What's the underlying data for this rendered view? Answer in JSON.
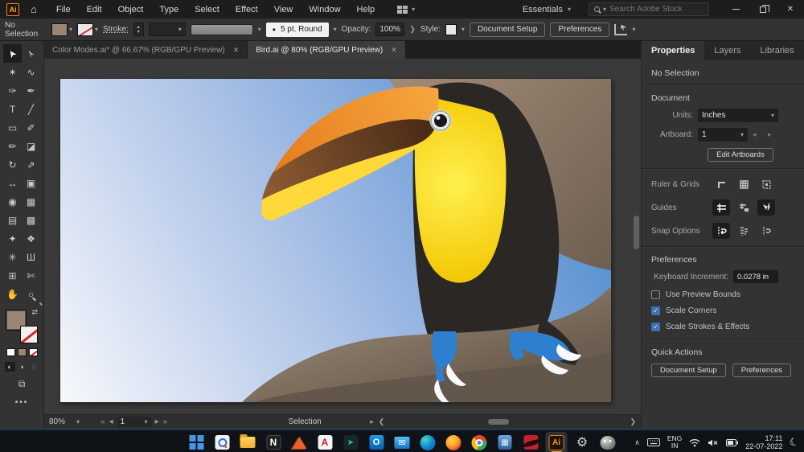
{
  "titlebar": {
    "app_logo": "Ai",
    "menus": [
      {
        "name": "menu-file",
        "label": "File"
      },
      {
        "name": "menu-edit",
        "label": "Edit"
      },
      {
        "name": "menu-object",
        "label": "Object"
      },
      {
        "name": "menu-type",
        "label": "Type"
      },
      {
        "name": "menu-select",
        "label": "Select"
      },
      {
        "name": "menu-effect",
        "label": "Effect"
      },
      {
        "name": "menu-view",
        "label": "View"
      },
      {
        "name": "menu-window",
        "label": "Window"
      },
      {
        "name": "menu-help",
        "label": "Help"
      }
    ],
    "workspace_label": "Essentials",
    "search_placeholder": "Search Adobe Stock"
  },
  "controlbar": {
    "selection_status": "No Selection",
    "stroke_label": "Stroke:",
    "brush_label": "5 pt. Round",
    "opacity_label": "Opacity:",
    "opacity_value": "100%",
    "style_label": "Style:",
    "document_setup_label": "Document Setup",
    "preferences_label": "Preferences",
    "fill_color": "#9b8674"
  },
  "document_tabs": [
    {
      "name": "tab-color-modes",
      "label": "Color Modes.ai* @ 66.67% (RGB/GPU Preview)"
    },
    {
      "name": "tab-bird",
      "label": "Bird.ai @ 80% (RGB/GPU Preview)",
      "active": true
    }
  ],
  "toolbar": {
    "tools": [
      {
        "name": "selection-tool",
        "glyph": "➤",
        "cls": "rot",
        "active": true
      },
      {
        "name": "direct-selection-tool",
        "glyph": "➢",
        "cls": "rot"
      },
      {
        "name": "magic-wand-tool",
        "glyph": "✶"
      },
      {
        "name": "lasso-tool",
        "glyph": "∿"
      },
      {
        "name": "curvature-tool",
        "glyph": "✑"
      },
      {
        "name": "pen-tool",
        "glyph": "✒"
      },
      {
        "name": "type-tool",
        "glyph": "T"
      },
      {
        "name": "line-segment-tool",
        "glyph": "╱"
      },
      {
        "name": "rectangle-tool",
        "glyph": "▭"
      },
      {
        "name": "paintbrush-tool",
        "glyph": "✐"
      },
      {
        "name": "pencil-tool",
        "glyph": "✏"
      },
      {
        "name": "eraser-tool",
        "glyph": "◪"
      },
      {
        "name": "rotate-tool",
        "glyph": "↻"
      },
      {
        "name": "scale-tool",
        "glyph": "⇗"
      },
      {
        "name": "width-tool",
        "glyph": "↔"
      },
      {
        "name": "free-transform-tool",
        "glyph": "▣"
      },
      {
        "name": "shape-builder-tool",
        "glyph": "◉"
      },
      {
        "name": "perspective-grid-tool",
        "glyph": "▦"
      },
      {
        "name": "mesh-tool",
        "glyph": "▤"
      },
      {
        "name": "gradient-tool",
        "glyph": "▩"
      },
      {
        "name": "eyedropper-tool",
        "glyph": "✦"
      },
      {
        "name": "blend-tool",
        "glyph": "❖"
      },
      {
        "name": "symbol-sprayer-tool",
        "glyph": "✳"
      },
      {
        "name": "column-graph-tool",
        "glyph": "Ш"
      },
      {
        "name": "artboard-tool",
        "glyph": "⊞"
      },
      {
        "name": "slice-tool",
        "glyph": "✄"
      },
      {
        "name": "hand-tool",
        "glyph": "✋"
      },
      {
        "name": "zoom-tool",
        "glyph": "○",
        "cls": "mag"
      }
    ]
  },
  "canvas": {
    "palette": {
      "sky_light": "#f7f8fb",
      "sky_mid": "#a9c0e6",
      "sky_deep": "#3f82ca",
      "trunk_light": "#a08a75",
      "trunk_dark": "#6e5f52",
      "branch_light": "#8d7c69",
      "branch_dark": "#6b5d4f",
      "branch_shadow": "#63564a",
      "body_black": "#2a2724",
      "bib_light": "#fff04f",
      "bib_deep": "#f2c500",
      "beak_yellow": "#ffd83a",
      "beak_orange_light": "#f5a63f",
      "beak_orange_deep": "#e67e1f",
      "beak_brown_light": "#8a5a33",
      "beak_brown_dark": "#4a2c15",
      "eye_ring": "#e6e9eb",
      "eye_pupil": "#17181a",
      "feet_blue": "#2f7fd1",
      "claw_white": "#f6f8f9"
    }
  },
  "statusbar": {
    "zoom_value": "80%",
    "artboard_value": "1",
    "tool_label": "Selection"
  },
  "properties_panel": {
    "tabs": [
      {
        "name": "tab-properties",
        "label": "Properties",
        "active": true
      },
      {
        "name": "tab-layers",
        "label": "Layers"
      },
      {
        "name": "tab-libraries",
        "label": "Libraries"
      }
    ],
    "no_selection_label": "No Selection",
    "document": {
      "title": "Document",
      "units_label": "Units:",
      "units_value": "Inches",
      "artboard_label": "Artboard:",
      "artboard_value": "1",
      "edit_artboards_label": "Edit Artboards",
      "ruler_grids_label": "Ruler & Grids",
      "guides_label": "Guides",
      "snap_label": "Snap Options"
    },
    "preferences": {
      "title": "Preferences",
      "keyboard_label": "Keyboard Increment:",
      "keyboard_value": "0.0278 in",
      "checks": [
        {
          "name": "checkbox-use-preview-bounds",
          "label": "Use Preview Bounds",
          "checked": false
        },
        {
          "name": "checkbox-scale-corners",
          "label": "Scale Corners",
          "checked": true
        },
        {
          "name": "checkbox-scale-strokes-effects",
          "label": "Scale Strokes & Effects",
          "checked": true
        }
      ]
    },
    "quick_actions": {
      "title": "Quick Actions",
      "document_setup_label": "Document Setup",
      "preferences_label": "Preferences"
    }
  },
  "taskbar": {
    "icons": [
      {
        "name": "start-icon",
        "cls": "ic-start"
      },
      {
        "name": "search-app-icon",
        "cls": "ic-searchapp"
      },
      {
        "name": "file-explorer-icon",
        "cls": "ic-folder"
      },
      {
        "name": "notebook-app-icon",
        "cls": "ic-napp",
        "label": "N"
      },
      {
        "name": "matlab-icon",
        "cls": "ic-matlab"
      },
      {
        "name": "autocad-icon",
        "cls": "ic-acad",
        "label": "A"
      },
      {
        "name": "green-arrow-app-icon",
        "cls": "ic-green",
        "label": "➤"
      },
      {
        "name": "outlook-icon",
        "cls": "ic-outlook",
        "label": "O"
      },
      {
        "name": "mail-icon",
        "cls": "ic-mail",
        "label": "✉"
      },
      {
        "name": "edge-icon",
        "cls": "ic-edge"
      },
      {
        "name": "firefox-icon",
        "cls": "ic-firefox"
      },
      {
        "name": "chrome-icon",
        "cls": "ic-chrome"
      },
      {
        "name": "calculator-icon",
        "cls": "ic-calc",
        "label": "▦"
      },
      {
        "name": "red-media-app-icon",
        "cls": "ic-red"
      },
      {
        "name": "illustrator-icon",
        "cls": "ic-ai",
        "label": "Ai",
        "active": true
      },
      {
        "name": "settings-icon",
        "cls": "ic-gear",
        "label": "⚙"
      },
      {
        "name": "gimp-icon",
        "cls": "ic-gimp"
      }
    ],
    "tray": {
      "lang_top": "ENG",
      "lang_bottom": "IN",
      "time": "17:11",
      "date": "22-07-2022"
    }
  }
}
